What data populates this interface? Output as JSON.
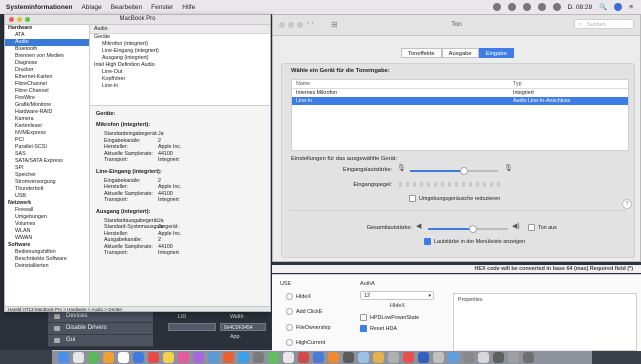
{
  "menubar": {
    "app": "Systeminformationen",
    "items": [
      "Ablage",
      "Bearbeiten",
      "Fenster",
      "Hilfe"
    ],
    "status": [
      "Q",
      "DE"
    ],
    "time": "D. 08:28"
  },
  "sysinfo": {
    "title": "MacBook Pro",
    "sidebar": [
      {
        "label": "Hardware",
        "group": true
      },
      {
        "label": "ATA"
      },
      {
        "label": "Audio",
        "selected": true
      },
      {
        "label": "Bluetooth"
      },
      {
        "label": "Brennen von Medien"
      },
      {
        "label": "Diagnose"
      },
      {
        "label": "Drucker"
      },
      {
        "label": "Ethernet-Karten"
      },
      {
        "label": "FibreChannel"
      },
      {
        "label": "Fibre-Channel"
      },
      {
        "label": "FireWire"
      },
      {
        "label": "Grafik/Monitore"
      },
      {
        "label": "Hardware-RAID"
      },
      {
        "label": "Kamera"
      },
      {
        "label": "Kartenleser"
      },
      {
        "label": "NVMExpress"
      },
      {
        "label": "PCI"
      },
      {
        "label": "Parallel-SCSI"
      },
      {
        "label": "SAS"
      },
      {
        "label": "SATA/SATA Express"
      },
      {
        "label": "SPI"
      },
      {
        "label": "Speicher"
      },
      {
        "label": "Stromversorgung"
      },
      {
        "label": "Thunderbolt"
      },
      {
        "label": "USB"
      },
      {
        "label": "Netzwerk",
        "group": true
      },
      {
        "label": "Firewall"
      },
      {
        "label": "Umgebungen"
      },
      {
        "label": "Volumes"
      },
      {
        "label": "WLAN"
      },
      {
        "label": "WWAN"
      },
      {
        "label": "Software",
        "group": true
      },
      {
        "label": "Bedienungshilfen"
      },
      {
        "label": "Beschränkte Software"
      },
      {
        "label": "Deinstallierten"
      }
    ],
    "device_list_header": "Audio",
    "device_list": [
      {
        "label": "Geräte",
        "level": 1
      },
      {
        "label": "Mikrofon (integriert)",
        "level": 2
      },
      {
        "label": "Line-Eingang (integriert)",
        "level": 2
      },
      {
        "label": "Ausgang (integriert)",
        "level": 2
      },
      {
        "label": "Intel High Definition Audio",
        "level": 1
      },
      {
        "label": "Line-Out",
        "level": 2
      },
      {
        "label": "Kopfhörer",
        "level": 2
      },
      {
        "label": "Line-In",
        "level": 2
      }
    ],
    "devices_heading": "Geräte:",
    "sections": [
      {
        "title": "Mikrofon (integriert):",
        "rows": [
          [
            "Standardeingabegerät:",
            "Ja"
          ],
          [
            "Eingabekanäle:",
            "2"
          ],
          [
            "Hersteller:",
            "Apple Inc."
          ],
          [
            "Aktuelle Samplerate:",
            "44100"
          ],
          [
            "Transport:",
            "Integriert"
          ]
        ]
      },
      {
        "title": "Line-Eingang (integriert):",
        "rows": [
          [
            "Eingabekanäle:",
            "2"
          ],
          [
            "Hersteller:",
            "Apple Inc."
          ],
          [
            "Aktuelle Samplerate:",
            "44100"
          ],
          [
            "Transport:",
            "Integriert"
          ]
        ]
      },
      {
        "title": "Ausgang (integriert):",
        "rows": [
          [
            "Standardausgabegerät:",
            "Ja"
          ],
          [
            "Standard-Systemausgabegerät:",
            "Ja"
          ],
          [
            "Hersteller:",
            "Apple Inc."
          ],
          [
            "Ausgabekanäle:",
            "2"
          ],
          [
            "Aktuelle Samplerate:",
            "44100"
          ],
          [
            "Transport:",
            "Integriert"
          ]
        ]
      }
    ],
    "path": "Harald HT13-MacBook Pro > Hardware > Audio > Geräte"
  },
  "sound": {
    "title": "Ton",
    "search_placeholder": "Suchen",
    "tabs": [
      "Toneffekte",
      "Ausgabe",
      "Eingabe"
    ],
    "active_tab": 2,
    "prompt": "Wähle ein Gerät für die Toneingabe:",
    "columns": [
      "Name",
      "Typ"
    ],
    "devices": [
      {
        "name": "Internes Mikrofon",
        "type": "Integriert",
        "selected": false
      },
      {
        "name": "Line-In",
        "type": "Audio Line-In-Anschluss",
        "selected": true
      }
    ],
    "settings_label": "Einstellungen für das ausgewählte Gerät:",
    "input_volume_label": "Eingangslautstärke:",
    "input_volume": 0.6,
    "input_level_label": "Eingangspegel:",
    "noise_reduction_label": "Umgebungsgeräusche reduzieren",
    "output_volume_label": "Gesamtlautstärke:",
    "output_volume": 0.55,
    "mute_label": "Ton aus",
    "menubar_label": "Lautstärke in der Menüleiste anzeigen",
    "menubar_checked": true,
    "accent": "#3f7de6"
  },
  "bottom_app": {
    "hex_note": "HEX code will be converted in base 64 (max) Required field (*)",
    "use_label": "USE",
    "use_options": [
      "HIdeX",
      "Add ClickE",
      "FileOwnership",
      "HighCurrent"
    ],
    "auth_label": "AuthA",
    "auth_select": "12",
    "auth_sub": "HIdeX",
    "auth_options": [
      "HPDLowPowerState",
      "Reset HDA"
    ],
    "params_label": "Properties"
  },
  "dark_list": [
    "Devices",
    "Disable Drivers",
    "Gui"
  ],
  "mid_fields": {
    "label1": "LID",
    "label2": "Width",
    "field1": "",
    "field2": "0x4C0F3454",
    "label3": "App."
  }
}
